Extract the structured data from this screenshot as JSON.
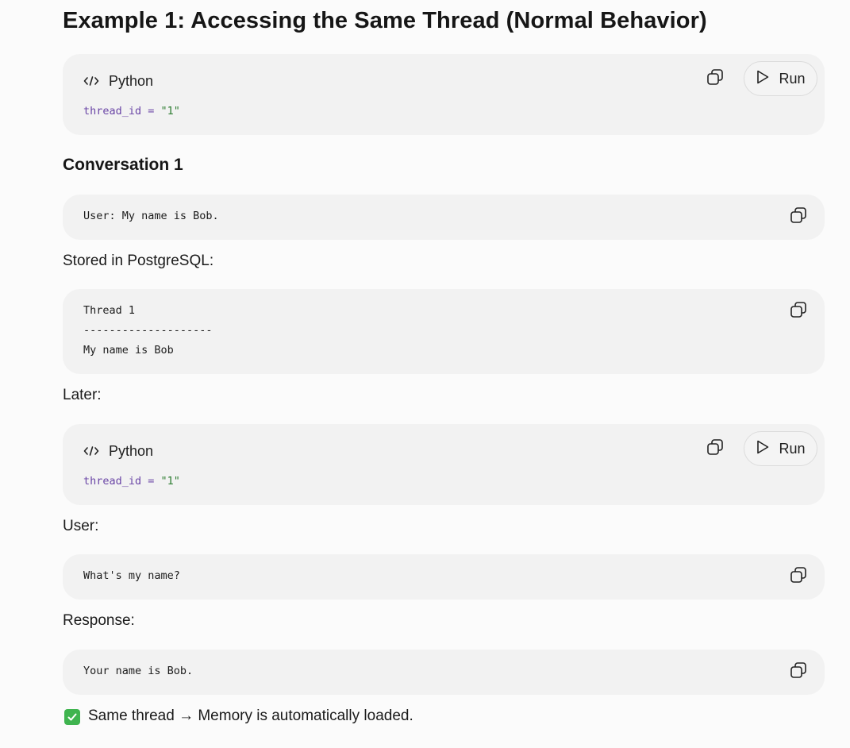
{
  "heading": "Example 1: Accessing the Same Thread (Normal Behavior)",
  "code_block_1": {
    "language": "Python",
    "code_var": "thread_id",
    "code_op": " = ",
    "code_str": "\"1\"",
    "run_label": "Run"
  },
  "section_title": "Conversation 1",
  "block_user_msg": {
    "text": "User: My name is Bob."
  },
  "label_stored": "Stored in PostgreSQL:",
  "block_stored": {
    "line1": "Thread 1",
    "line2": "--------------------",
    "line3": "My name is Bob"
  },
  "label_later": "Later:",
  "code_block_2": {
    "language": "Python",
    "code_var": "thread_id",
    "code_op": " = ",
    "code_str": "\"1\"",
    "run_label": "Run"
  },
  "label_user": "User:",
  "block_question": {
    "text": "What's my name?"
  },
  "label_response": "Response:",
  "block_response": {
    "text": "Your name is Bob."
  },
  "footer_note": "Same thread → Memory is automatically loaded.",
  "colors": {
    "background": "#fbfbfb",
    "block": "#f2f2f2",
    "code_variable": "#6a45a6",
    "code_string": "#2e7d32",
    "check": "#3fb44f"
  },
  "icons": [
    "code-icon",
    "copy-icon",
    "play-icon",
    "check-icon"
  ]
}
